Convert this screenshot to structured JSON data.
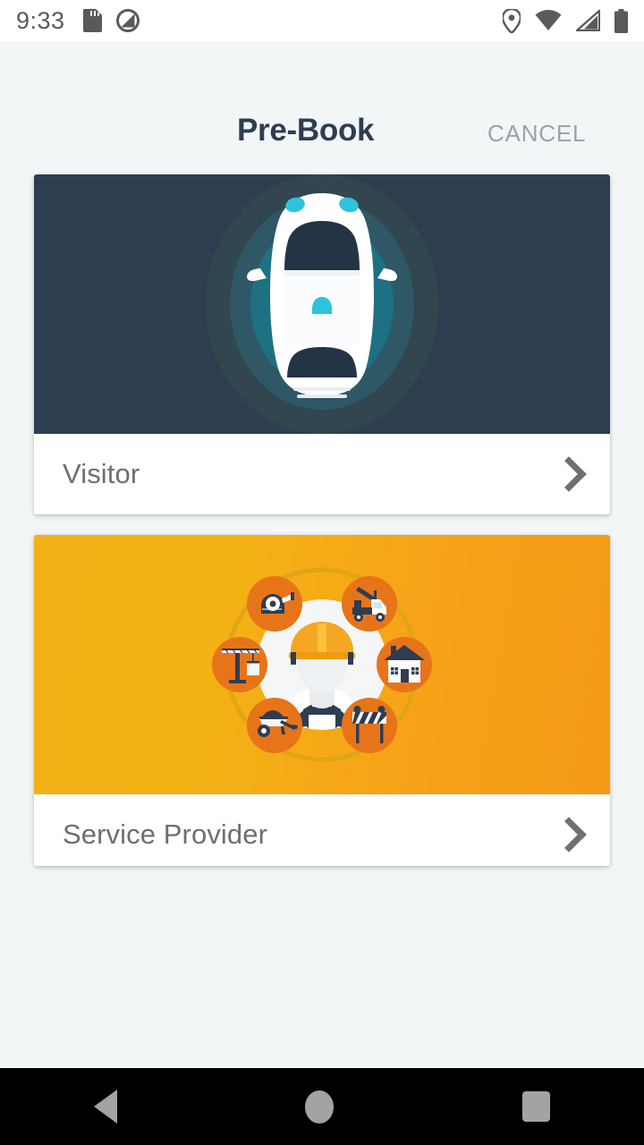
{
  "status_bar": {
    "time": "9:33",
    "left_icons": [
      {
        "name": "sd-card-icon"
      },
      {
        "name": "do-not-disturb-icon"
      }
    ],
    "right_icons": [
      {
        "name": "location-pin-icon"
      },
      {
        "name": "wifi-icon"
      },
      {
        "name": "cellular-signal-icon"
      },
      {
        "name": "battery-icon"
      }
    ]
  },
  "header": {
    "title": "Pre-Book",
    "cancel_label": "CANCEL"
  },
  "cards": [
    {
      "id": "visitor",
      "label": "Visitor",
      "illustration": "car-top-view-with-radar-rings",
      "media_background": "#2d3e50",
      "accent_colors": [
        "#2d4a57",
        "#1d6b7e",
        "#29c0d8"
      ],
      "chevron": "chevron-right-icon"
    },
    {
      "id": "service-provider",
      "label": "Service Provider",
      "illustration": "construction-worker-with-service-icons",
      "media_background": "#f2b116",
      "accent_colors": [
        "#e8741a",
        "#f0a500",
        "#2e3d52"
      ],
      "service_icons": [
        "tape-measure-icon",
        "tow-truck-icon",
        "house-icon",
        "road-barrier-icon",
        "wheelbarrow-icon",
        "crane-icon"
      ],
      "chevron": "chevron-right-icon"
    }
  ],
  "nav_bar": {
    "back_label": "back-button",
    "home_label": "home-button",
    "recents_label": "recents-button"
  },
  "colors": {
    "page_background": "#f2f6f7",
    "title_color": "#2e3d52",
    "cancel_color": "#9aa3ab",
    "card_label_color": "#6f6f6f",
    "nav_background": "#000000"
  }
}
